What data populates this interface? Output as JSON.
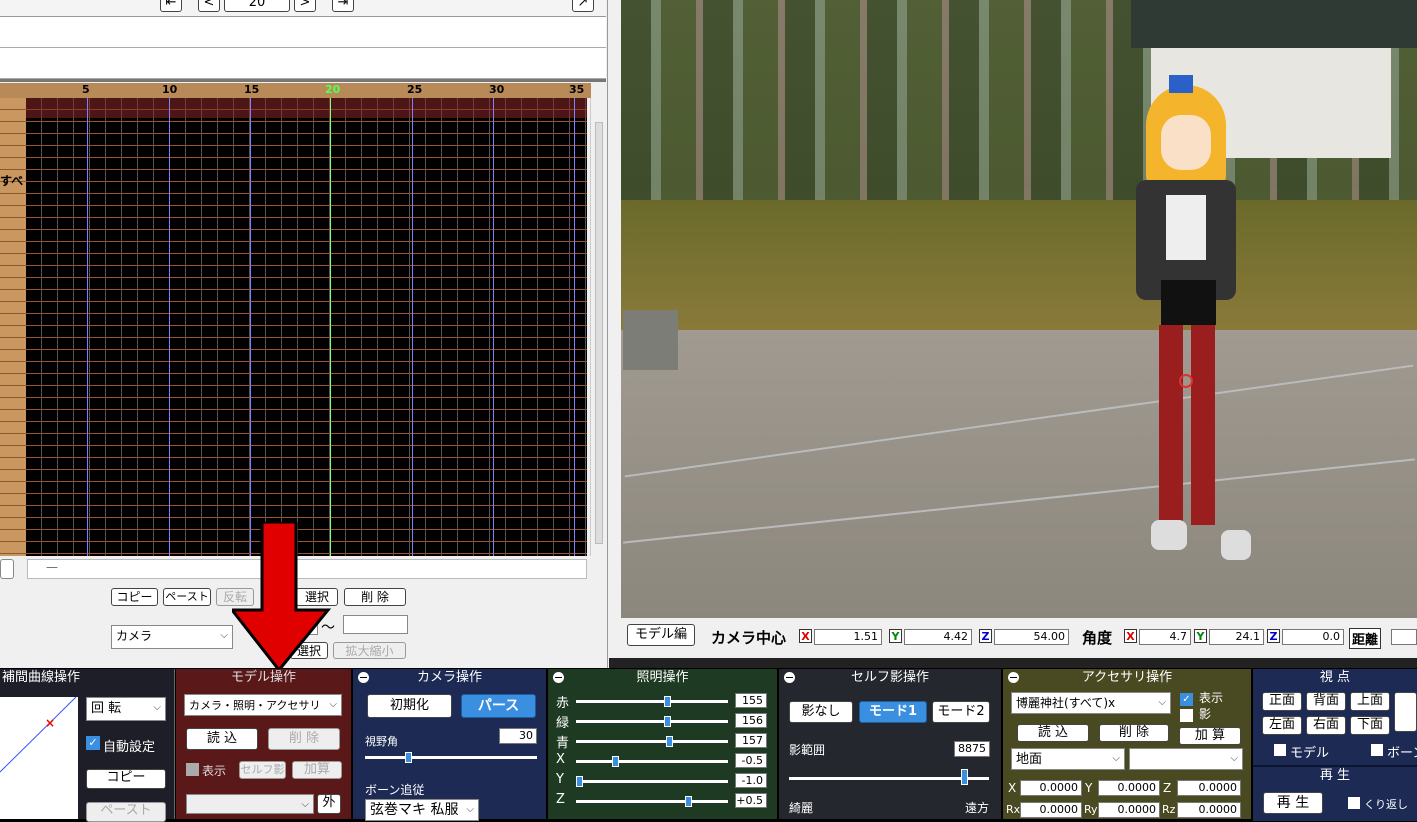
{
  "timeline": {
    "frame_value": "20",
    "ruler_ticks": [
      "5",
      "10",
      "15",
      "20",
      "25",
      "30",
      "35"
    ],
    "row_label": "すべ",
    "buttons": {
      "copy": "コピー",
      "paste": "ペースト",
      "reverse": "反転",
      "select": "選択",
      "delete": "削 除"
    },
    "dropdown_value": "カメラ",
    "range_sep": "〜",
    "select2": "選択",
    "scale": "拡大縮小",
    "scroll_dash": "—"
  },
  "viewport": {
    "mode_button": "モデル編",
    "cam_center_label": "カメラ中心",
    "cx": "1.51",
    "cy": "4.42",
    "cz": "54.00",
    "angle_label": "角度",
    "ax": "4.7",
    "ay": "24.1",
    "az": "0.0",
    "dist_label": "距離",
    "x": "X",
    "y": "Y",
    "z": "Z"
  },
  "interp_panel": {
    "title": "補間曲線操作",
    "rotate": "回 転",
    "auto": "自動設定",
    "copy": "コピー",
    "paste": "ペースト"
  },
  "model_panel": {
    "title": "モデル操作",
    "select": "カメラ・照明・アクセサリ",
    "load": "読 込",
    "delete": "削 除",
    "show": "表示",
    "selfshadow": "セルフ影",
    "add": "加算",
    "outer": "外"
  },
  "camera_panel": {
    "title": "カメラ操作",
    "init": "初期化",
    "perspective": "パース",
    "fov_label": "視野角",
    "fov_value": "30",
    "bone_follow": "ボーン追従",
    "model_select": "弦巻マキ 私服"
  },
  "light_panel": {
    "title": "照明操作",
    "rows": [
      {
        "label": "赤",
        "value": "155",
        "level": 0.61
      },
      {
        "label": "緑",
        "value": "156",
        "level": 0.61
      },
      {
        "label": "青",
        "value": "157",
        "level": 0.62
      },
      {
        "label": "X",
        "value": "-0.5",
        "level": 0.25
      },
      {
        "label": "Y",
        "value": "-1.0",
        "level": 0.0
      },
      {
        "label": "Z",
        "value": "+0.5",
        "level": 0.75
      }
    ]
  },
  "shadow_panel": {
    "title": "セルフ影操作",
    "none": "影なし",
    "mode1": "モード1",
    "mode2": "モード2",
    "range_label": "影範囲",
    "range_value": "8875",
    "range_level": 0.89,
    "pretty": "綺麗",
    "far": "遠方"
  },
  "acc_panel": {
    "title": "アクセサリ操作",
    "select": "博麗神社(すべて)x",
    "show": "表示",
    "shadow": "影",
    "load": "読 込",
    "delete": "削 除",
    "add": "加 算",
    "ground": "地面",
    "x": "X",
    "y": "Y",
    "z": "Z",
    "rx": "Rx",
    "ry": "Ry",
    "rz": "Rz",
    "vx": "0.0000",
    "vy": "0.0000",
    "vz": "0.0000",
    "vrx": "0.0000",
    "vry": "0.0000",
    "vrz": "0.0000"
  },
  "view_panel": {
    "title": "視 点",
    "front": "正面",
    "back": "背面",
    "top": "上面",
    "left": "左面",
    "right": "右面",
    "bottom": "下面",
    "model": "モデル",
    "bone": "ボーン",
    "play_title": "再 生",
    "play": "再 生",
    "repeat": "くり返し"
  }
}
